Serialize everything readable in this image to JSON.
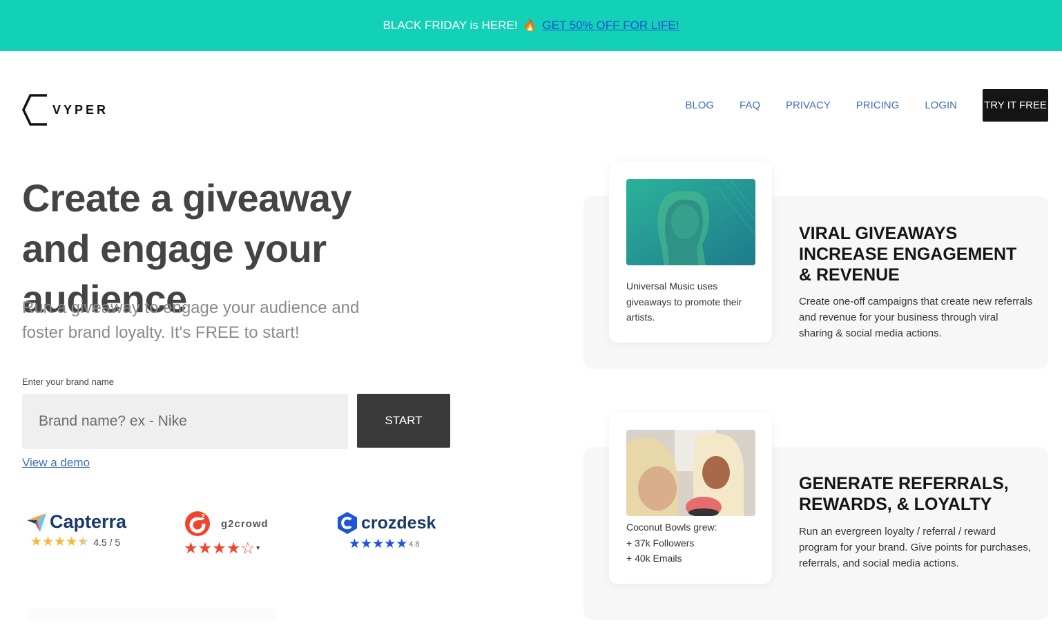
{
  "banner": {
    "text": "BLACK FRIDAY is HERE!",
    "emoji": "🔥",
    "link": "GET 50% OFF FOR LIFE!"
  },
  "logo": {
    "text": "VYPER"
  },
  "nav": {
    "items": [
      "BLOG",
      "FAQ",
      "PRIVACY",
      "PRICING",
      "LOGIN"
    ],
    "cta": "TRY IT FREE"
  },
  "hero": {
    "title": "Create a giveaway and engage your audience",
    "subtitle": "Run a giveaway to engage your audience and foster brand loyalty. It's FREE to start!",
    "input_label": "Enter your brand name",
    "input_placeholder": "Brand name? ex - Nike",
    "start_label": "START",
    "demo_link": "View a demo"
  },
  "reviews": {
    "capterra": {
      "name": "Capterra",
      "rating_text": "4.5 / 5",
      "stars": 4.5
    },
    "g2": {
      "name": "g2crowd",
      "stars": 4.5
    },
    "crozdesk": {
      "name": "crozdesk",
      "rating_text": "4.8",
      "stars": 5
    }
  },
  "features": [
    {
      "card_text": "Universal Music uses giveaways to promote their artists.",
      "title": "VIRAL GIVEAWAYS INCREASE ENGAGEMENT & REVENUE",
      "description": "Create one-off campaigns that create new referrals and revenue for your business through viral sharing & social media actions."
    },
    {
      "card_lines": [
        "Coconut Bowls grew:",
        "+ 37k Followers",
        "+ 40k Emails"
      ],
      "title": "GENERATE REFERRALS, REWARDS, & LOYALTY",
      "description": "Run an evergreen loyalty / referral / reward program for your brand. Give points for purchases, referrals, and social media actions."
    }
  ],
  "colors": {
    "banner_bg": "#12d1b6",
    "nav_link": "#3f6fb5",
    "cta_bg": "#151515",
    "capterra_star": "#f5b93a",
    "g2_star": "#f0452d",
    "crozdesk_star": "#1a56d6"
  }
}
